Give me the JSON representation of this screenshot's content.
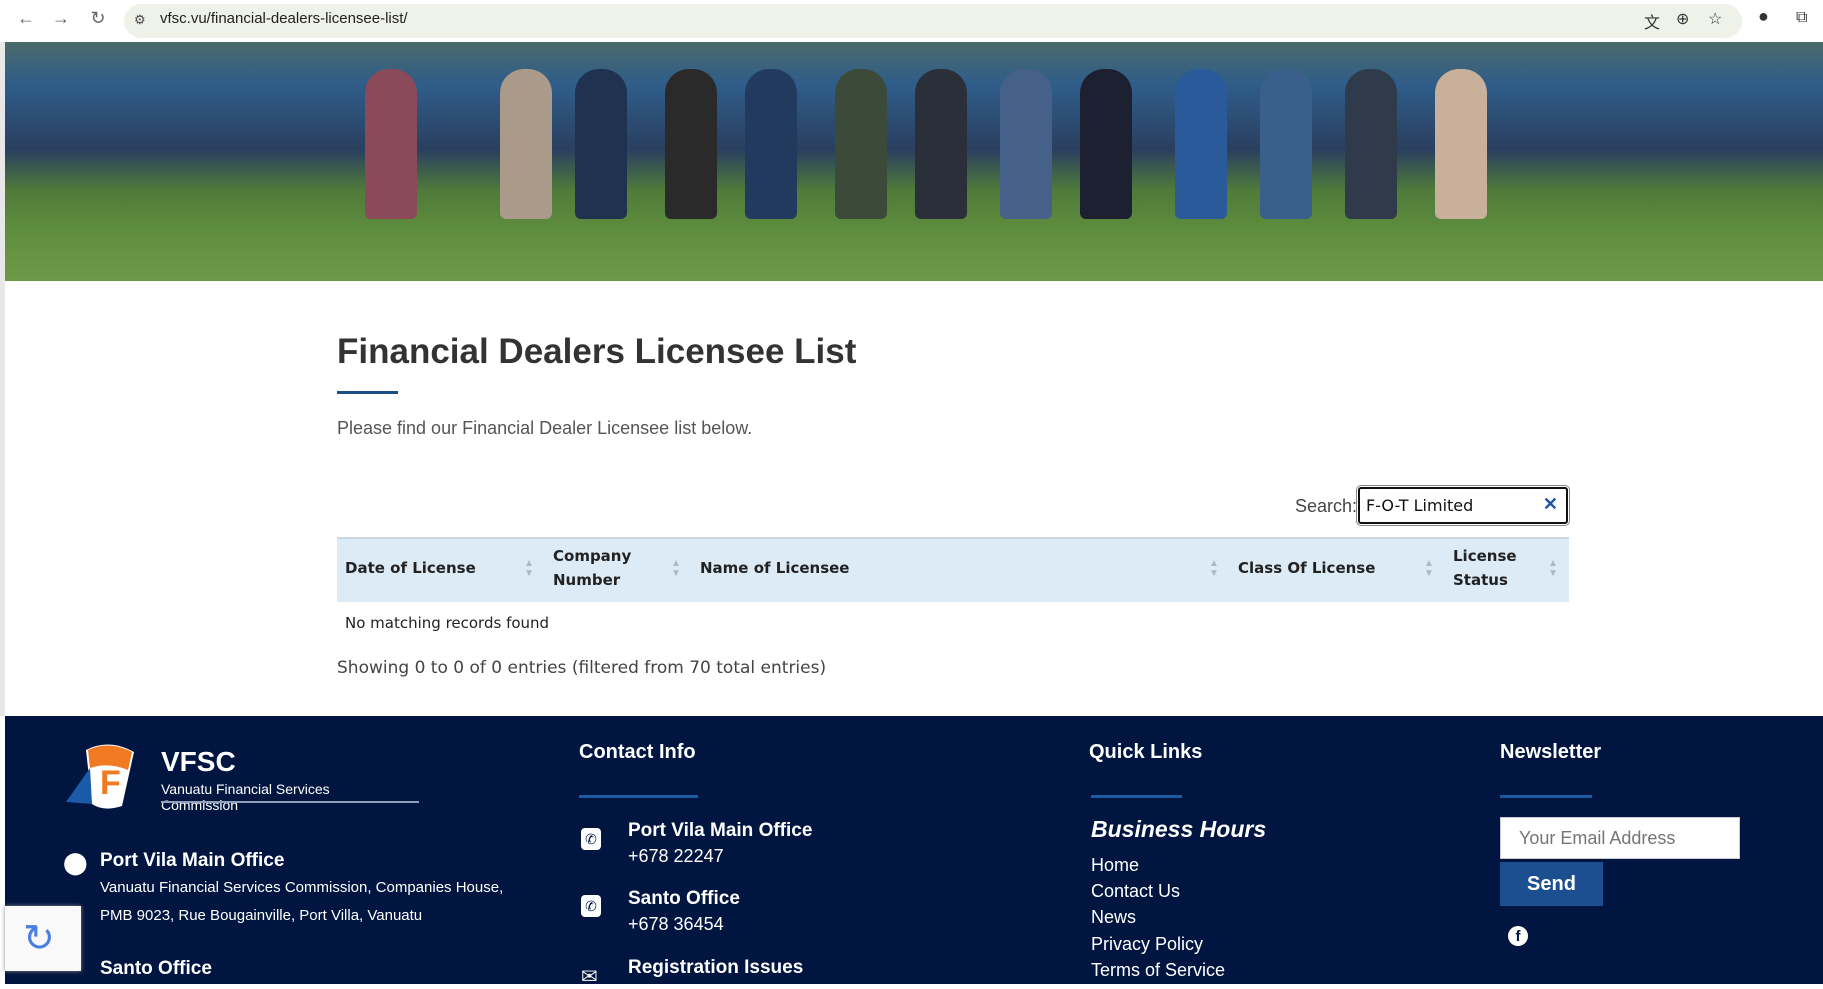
{
  "browser": {
    "url": "vfsc.vu/financial-dealers-licensee-list/"
  },
  "page": {
    "title": "Financial Dealers Licensee List",
    "subtitle": "Please find our Financial Dealer Licensee list below."
  },
  "search": {
    "label": "Search:",
    "value": "F-O-T Limited",
    "clear": "✕"
  },
  "table": {
    "columns": [
      {
        "l1": "Date of License",
        "l2": ""
      },
      {
        "l1": "Company",
        "l2": "Number"
      },
      {
        "l1": "Name of Licensee",
        "l2": ""
      },
      {
        "l1": "Class Of License",
        "l2": ""
      },
      {
        "l1": "License",
        "l2": "Status"
      }
    ],
    "empty": "No matching records found",
    "info": "Showing 0 to 0 of 0 entries (filtered from 70 total entries)"
  },
  "footer": {
    "logo": {
      "name": "VFSC",
      "full": "Vanuatu Financial Services Commission"
    },
    "offices": [
      {
        "name": "Port Vila Main Office",
        "line1": "Vanuatu Financial Services Commission, Companies House,",
        "line2": "PMB 9023, Rue Bougainville, Port Villa, Vanuatu"
      },
      {
        "name": "Santo Office"
      }
    ],
    "contact": {
      "heading": "Contact Info",
      "items": [
        {
          "name": "Port Vila Main Office",
          "phone": "+678 22247"
        },
        {
          "name": "Santo Office",
          "phone": "+678 36454"
        },
        {
          "name": "Registration Issues"
        }
      ]
    },
    "quick": {
      "heading": "Quick Links",
      "sub": "Business Hours",
      "links": [
        "Home",
        "Contact Us",
        "News",
        "Privacy Policy",
        "Terms of Service"
      ]
    },
    "newsletter": {
      "heading": "Newsletter",
      "placeholder": "Your Email Address",
      "send": "Send"
    }
  },
  "colors": {
    "footer": "#001540",
    "accent": "#1a5a9e",
    "thead": "#dcebf5"
  }
}
